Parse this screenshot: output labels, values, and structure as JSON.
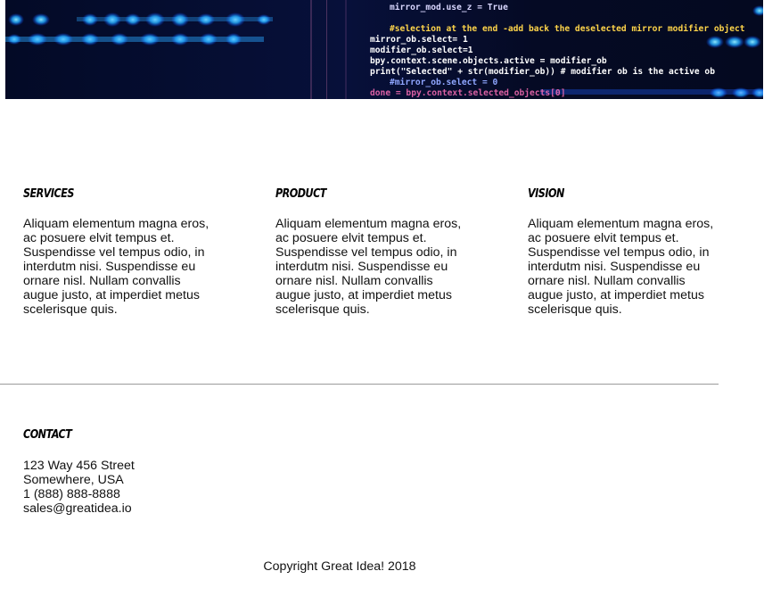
{
  "hero": {
    "code_lines": [
      "mirror_mod.use_z = True",
      "#selection at the end -add back the deselected mirror modifier object",
      "mirror_ob.select= 1",
      "modifier_ob.select=1",
      "bpy.context.scene.objects.active = modifier_ob",
      "print(\"Selected\" + str(modifier_ob)) # modifier ob is the active ob",
      "#mirror_ob.select = 0",
      "done = bpy.context.selected_objects[0]"
    ]
  },
  "features": [
    {
      "title": "Services",
      "body": "Aliquam elementum magna eros, ac posuere elvit tempus et. Suspendisse vel tempus odio, in interdutm nisi. Suspendisse eu ornare nisl. Nullam convallis augue justo, at imperdiet metus scelerisque quis."
    },
    {
      "title": "Product",
      "body": "Aliquam elementum magna eros, ac posuere elvit tempus et. Suspendisse vel tempus odio, in interdutm nisi. Suspendisse eu ornare nisl. Nullam convallis augue justo, at imperdiet metus scelerisque quis."
    },
    {
      "title": "Vision",
      "body": "Aliquam elementum magna eros, ac posuere elvit tempus et. Suspendisse vel tempus odio, in interdutm nisi. Suspendisse eu ornare nisl. Nullam convallis augue justo, at imperdiet metus scelerisque quis."
    }
  ],
  "contact": {
    "title": "Contact",
    "street": "123 Way 456 Street",
    "city": "Somewhere, USA",
    "phone": "1 (888) 888-8888",
    "email": "sales@greatidea.io"
  },
  "footer": {
    "copyright": "Copyright Great Idea! 2018"
  }
}
